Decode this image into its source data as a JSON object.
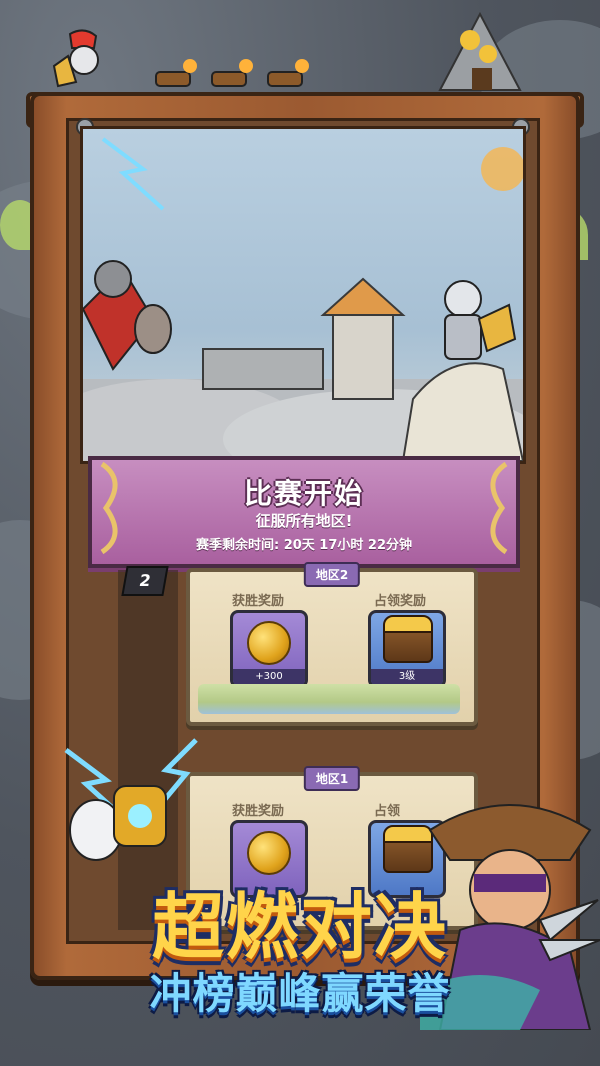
{
  "banner": {
    "title": "比赛开始",
    "subtitle": "征服所有地区!",
    "season_timer": "赛季剩余时间: 20天 17小时 22分钟"
  },
  "level_badge": "2",
  "regions": [
    {
      "tag": "地区2",
      "win_reward_label": "获胜奖励",
      "occupy_reward_label": "占领奖励",
      "win_reward_count": "+300",
      "occupy_reward_count": "3级",
      "win_reward_icon": "gold-coin-icon",
      "occupy_reward_icon": "treasure-chest-icon"
    },
    {
      "tag": "地区1",
      "win_reward_label": "获胜奖励",
      "occupy_reward_label": "占领",
      "win_reward_icon": "gold-coin-icon",
      "occupy_reward_icon": "treasure-chest-icon"
    }
  ],
  "slogan": {
    "headline": "超燃对决",
    "tagline": "冲榜巅峰赢荣誉"
  },
  "colors": {
    "banner": "#b46ea9",
    "card": "#e9dab8",
    "frame": "#a5623a",
    "headline": "#ffd44a",
    "tagline": "#7fd8ff"
  }
}
